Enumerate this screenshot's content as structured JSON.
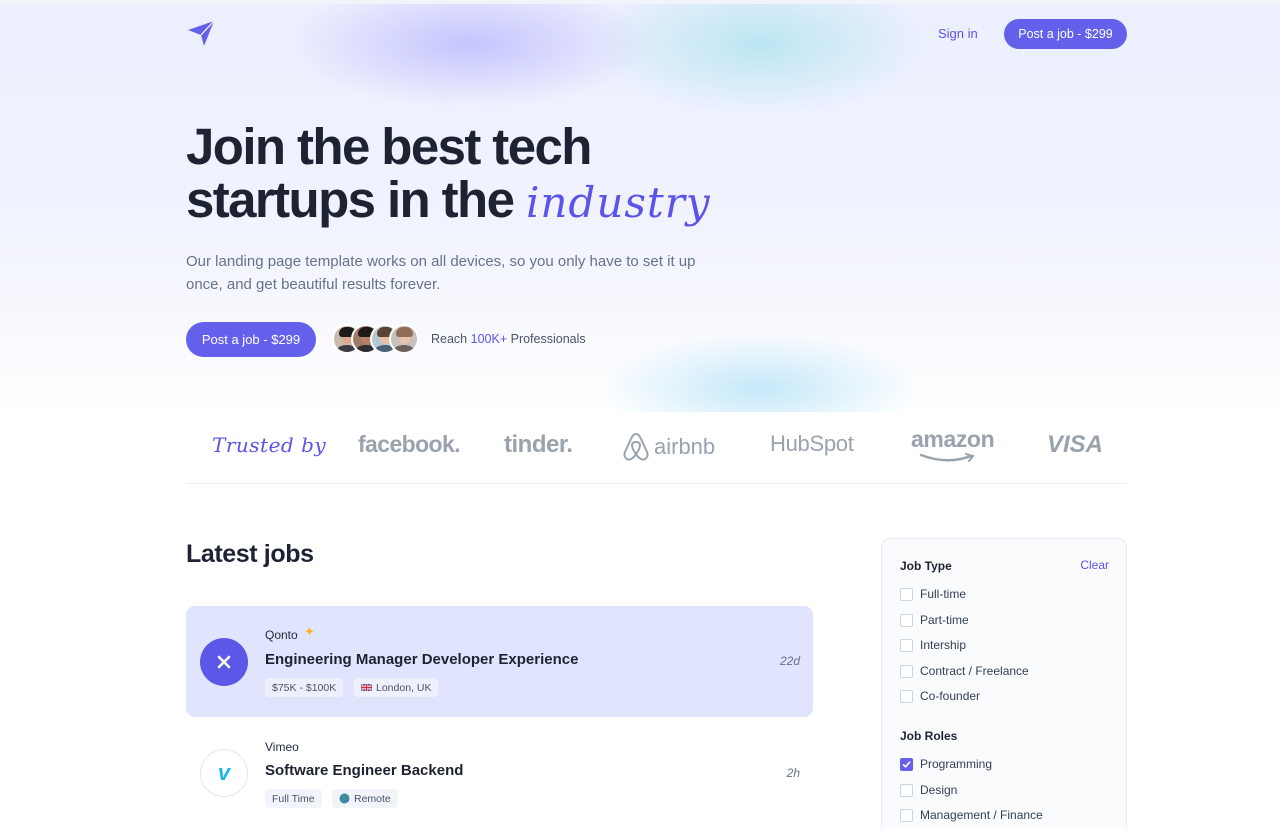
{
  "nav": {
    "signin_label": "Sign in",
    "post_job_label": "Post a job - $299"
  },
  "hero": {
    "title_line1": "Join the best tech",
    "title_line2": "startups in the",
    "title_script": "industry",
    "subtitle": "Our landing page template works on all devices, so you only have to set it up once, and get beautiful results forever.",
    "cta_label": "Post a job - $299",
    "reach_prefix": "Reach",
    "reach_count": "100K+",
    "reach_suffix": "Professionals"
  },
  "trusted": {
    "label": "Trusted by",
    "brands": [
      "facebook.",
      "tinder.",
      "airbnb",
      "HubSpot",
      "amazon",
      "VISA"
    ]
  },
  "jobs": {
    "title": "Latest jobs",
    "items": [
      {
        "company": "Qonto",
        "title": "Engineering Manager Developer Experience",
        "tags": [
          "$75K - $100K",
          "London, UK"
        ],
        "age": "22d",
        "featured": true
      },
      {
        "company": "Vimeo",
        "title": "Software Engineer Backend",
        "tags": [
          "Full Time",
          "Remote"
        ],
        "age": "2h",
        "featured": false
      }
    ]
  },
  "filters": {
    "job_type": {
      "title": "Job Type",
      "clear_label": "Clear",
      "options": [
        "Full-time",
        "Part-time",
        "Intership",
        "Contract / Freelance",
        "Co-founder"
      ]
    },
    "job_roles": {
      "title": "Job Roles",
      "options": [
        "Programming",
        "Design",
        "Management / Finance"
      ],
      "checked": [
        "Programming"
      ]
    }
  },
  "colors": {
    "accent": "#6560ec",
    "featured_bg": "#e1e4fd",
    "star": "#f5b51e"
  }
}
